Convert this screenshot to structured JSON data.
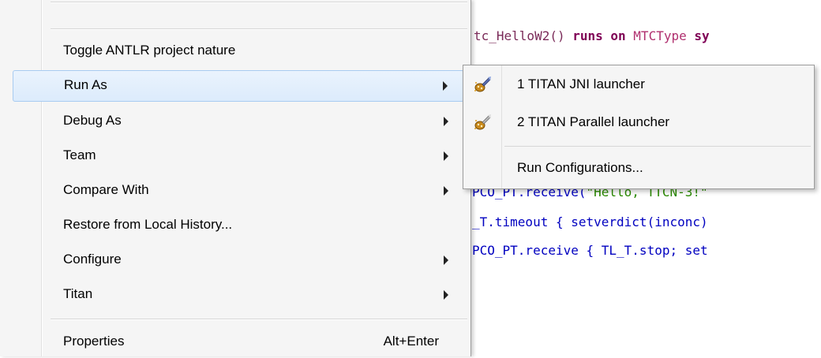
{
  "editor": {
    "lines": [
      {
        "parts": [
          {
            "t": "tc_HelloW2() ",
            "c": "fn"
          },
          {
            "t": "runs on ",
            "c": "kw"
          },
          {
            "t": "MTCType ",
            "c": "type"
          },
          {
            "t": "sy",
            "c": "kw"
          }
        ]
      },
      {
        "parts": [
          {
            "t": "PCO_PT",
            "c": "port"
          },
          {
            "t": ".receive(",
            "c": "port"
          },
          {
            "t": "\"Hello, TTCN-3!\"",
            "c": "str"
          }
        ]
      },
      {
        "parts": [
          {
            "t": "_T",
            "c": "port"
          },
          {
            "t": ".timeout { ",
            "c": "port"
          },
          {
            "t": "setverdict(inconc)",
            "c": "port"
          }
        ]
      },
      {
        "parts": [
          {
            "t": "PCO_PT",
            "c": "port"
          },
          {
            "t": ".receive { ",
            "c": "port"
          },
          {
            "t": "TL_T",
            "c": "port"
          },
          {
            "t": ".stop; set",
            "c": "port"
          }
        ]
      }
    ]
  },
  "menu": {
    "items": [
      {
        "label": "Toggle ANTLR project nature",
        "submenu": false
      },
      {
        "label": "Run As",
        "submenu": true,
        "highlighted": true
      },
      {
        "label": "Debug As",
        "submenu": true
      },
      {
        "label": "Team",
        "submenu": true
      },
      {
        "label": "Compare With",
        "submenu": true
      },
      {
        "label": "Restore from Local History...",
        "submenu": false
      },
      {
        "label": "Configure",
        "submenu": true
      },
      {
        "label": "Titan",
        "submenu": true
      },
      {
        "label": "Properties",
        "submenu": false,
        "accelerator": "Alt+Enter"
      }
    ]
  },
  "submenu": {
    "items": [
      {
        "label": "1 TITAN JNI launcher",
        "icon": "titan-launcher-icon"
      },
      {
        "label": "2 TITAN Parallel launcher",
        "icon": "titan-parallel-launcher-icon"
      },
      {
        "label": "Run Configurations..."
      }
    ]
  }
}
